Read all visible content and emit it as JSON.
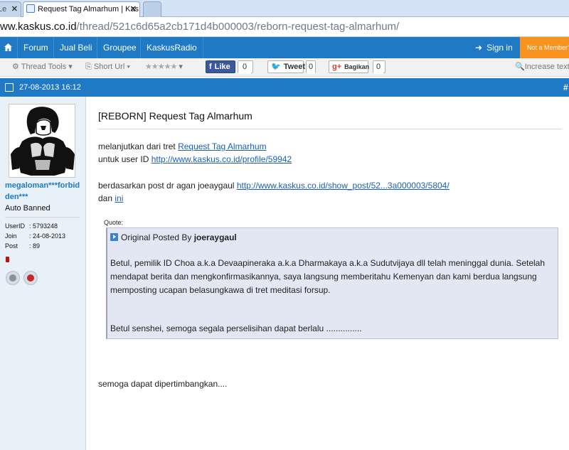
{
  "browser": {
    "tabs": [
      {
        "label": "Le",
        "active": false
      },
      {
        "label": "Request Tag Almarhum | Kas",
        "active": true
      },
      {
        "label": "",
        "active": false
      }
    ],
    "url_host": "ww.kaskus.co.id",
    "url_path": "/thread/521c6d65a2cb171d4b000003/reborn-request-tag-almarhum/"
  },
  "nav": {
    "items": [
      "Forum",
      "Jual Beli",
      "Groupee",
      "KaskusRadio"
    ],
    "signin": "Sign in",
    "not_member": "Not a Member?"
  },
  "toolbar": {
    "thread_tools": "Thread Tools",
    "short_url": "Short Url",
    "rating_stars": "★★★★★",
    "fb_label": "Like",
    "fb_count": "0",
    "tw_label": "Tweet",
    "tw_count": "0",
    "gp_label": "Bagikan",
    "gp_count": "0",
    "increase_text": "Increase text"
  },
  "post": {
    "date": "27-08-2013 16:12",
    "permalink": "#",
    "title": "[REBORN] Request Tag Almarhum",
    "line1_prefix": "melanjutkan dari tret ",
    "line1_link": "Request Tag Almarhum",
    "line2_prefix": "untuk user ID ",
    "line2_link": "http://www.kaskus.co.id/profile/59942",
    "line3_prefix": "berdasarkan post dr agan joeaygaul ",
    "line3_link": "http://www.kaskus.co.id/show_post/52...3a000003/5804/",
    "line4_prefix": "dan ",
    "line4_link": "ini",
    "quote_label": "Quote:",
    "quote_head_prefix": "Original Posted By ",
    "quote_author": "joeraygaul",
    "quote_p1": "Betul, pemilik ID Choa a.k.a Devaapineraka a.k.a Dharmakaya a.k.a Sudutvijaya dll telah meninggal dunia. Setelah mendapat berita dan mengkonfirmasikannya, saya langsung memberitahu Kemenyan dan kami berdua langsung memposting ucapan belasungkawa di tret meditasi forsup.",
    "quote_p2": "Betul senshei, semoga segala perselisihan dapat berlalu ...............",
    "closing": "semoga dapat dipertimbangkan...."
  },
  "user": {
    "name": "megaloman***forbidden***",
    "status": "Auto Banned",
    "userid_label": "UserID",
    "userid": ": 5793248",
    "join_label": "Join",
    "join": ": 24-08-2013",
    "post_label": "Post",
    "post": ": 89"
  },
  "colors": {
    "nav_blue": "#1f79c4",
    "orange": "#f7931e",
    "link": "#1a5fb4"
  }
}
